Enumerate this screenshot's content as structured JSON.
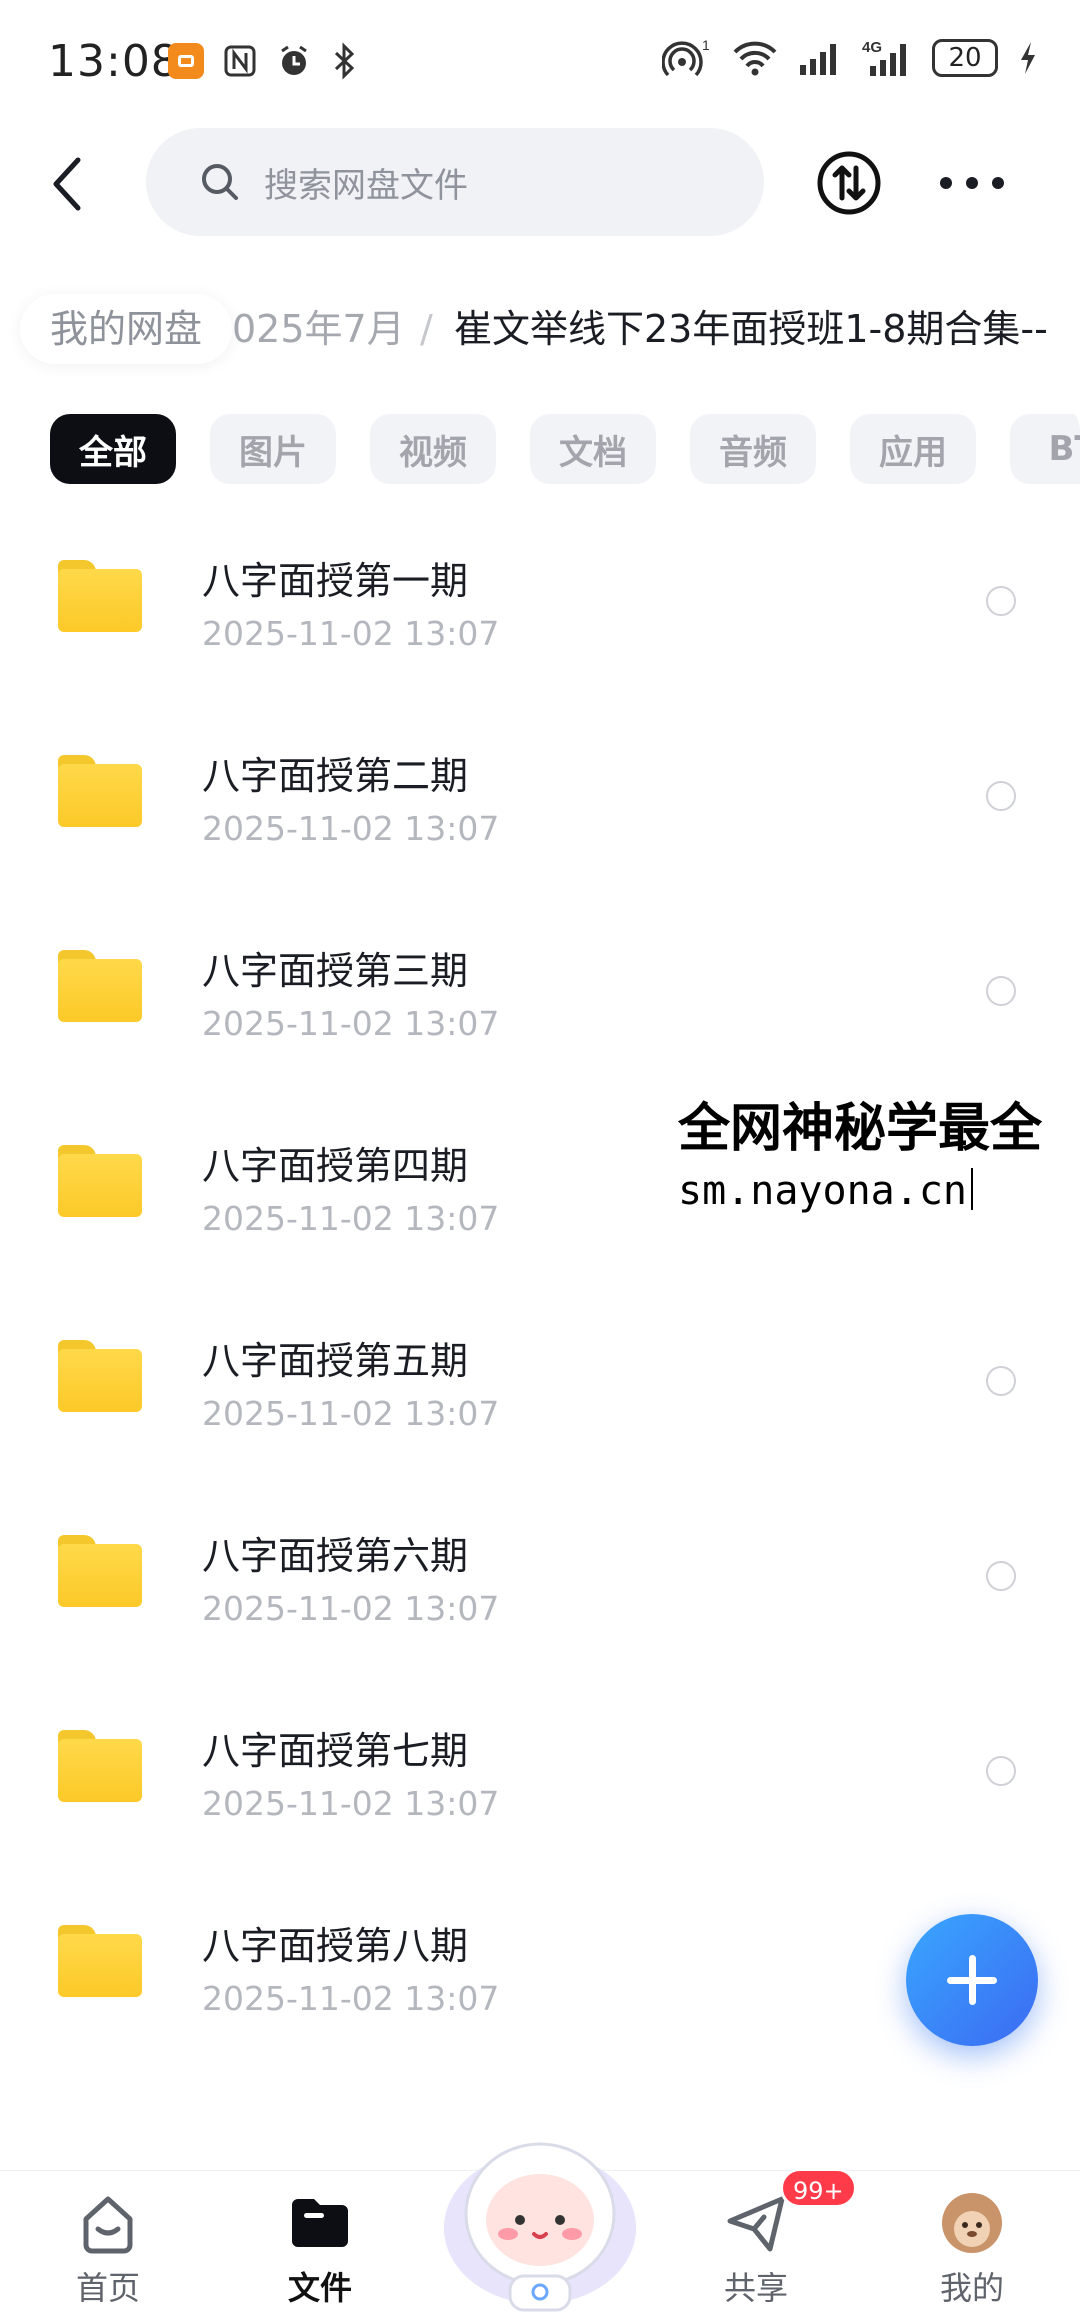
{
  "status_bar": {
    "time": "13:08",
    "signal_sup": "1",
    "network": "4G",
    "battery": "20"
  },
  "header": {
    "search_placeholder": "搜索网盘文件"
  },
  "breadcrumb": {
    "root": "我的网盘",
    "middle": "025年7月",
    "separator": "/",
    "current": "崔文举线下23年面授班1-8期合集--"
  },
  "filters": [
    {
      "label": "全部",
      "active": true
    },
    {
      "label": "图片",
      "active": false
    },
    {
      "label": "视频",
      "active": false
    },
    {
      "label": "文档",
      "active": false
    },
    {
      "label": "音频",
      "active": false
    },
    {
      "label": "应用",
      "active": false
    },
    {
      "label": "BT",
      "active": false
    }
  ],
  "files": [
    {
      "name": "八字面授第一期",
      "date": "2025-11-02  13:07"
    },
    {
      "name": "八字面授第二期",
      "date": "2025-11-02  13:07"
    },
    {
      "name": "八字面授第三期",
      "date": "2025-11-02  13:07"
    },
    {
      "name": "八字面授第四期",
      "date": "2025-11-02  13:07"
    },
    {
      "name": "八字面授第五期",
      "date": "2025-11-02  13:07"
    },
    {
      "name": "八字面授第六期",
      "date": "2025-11-02  13:07"
    },
    {
      "name": "八字面授第七期",
      "date": "2025-11-02  13:07"
    },
    {
      "name": "八字面授第八期",
      "date": "2025-11-02  13:07"
    }
  ],
  "watermark": {
    "line1": "全网神秘学最全",
    "line2": "sm.nayona.cn"
  },
  "tabbar": {
    "home": "首页",
    "files": "文件",
    "share": "共享",
    "share_badge": "99+",
    "me": "我的"
  },
  "colors": {
    "accent": "#3b82f6",
    "folder": "#fcc928",
    "chip_active": "#0d0e14",
    "badge": "#ff3b4a"
  }
}
